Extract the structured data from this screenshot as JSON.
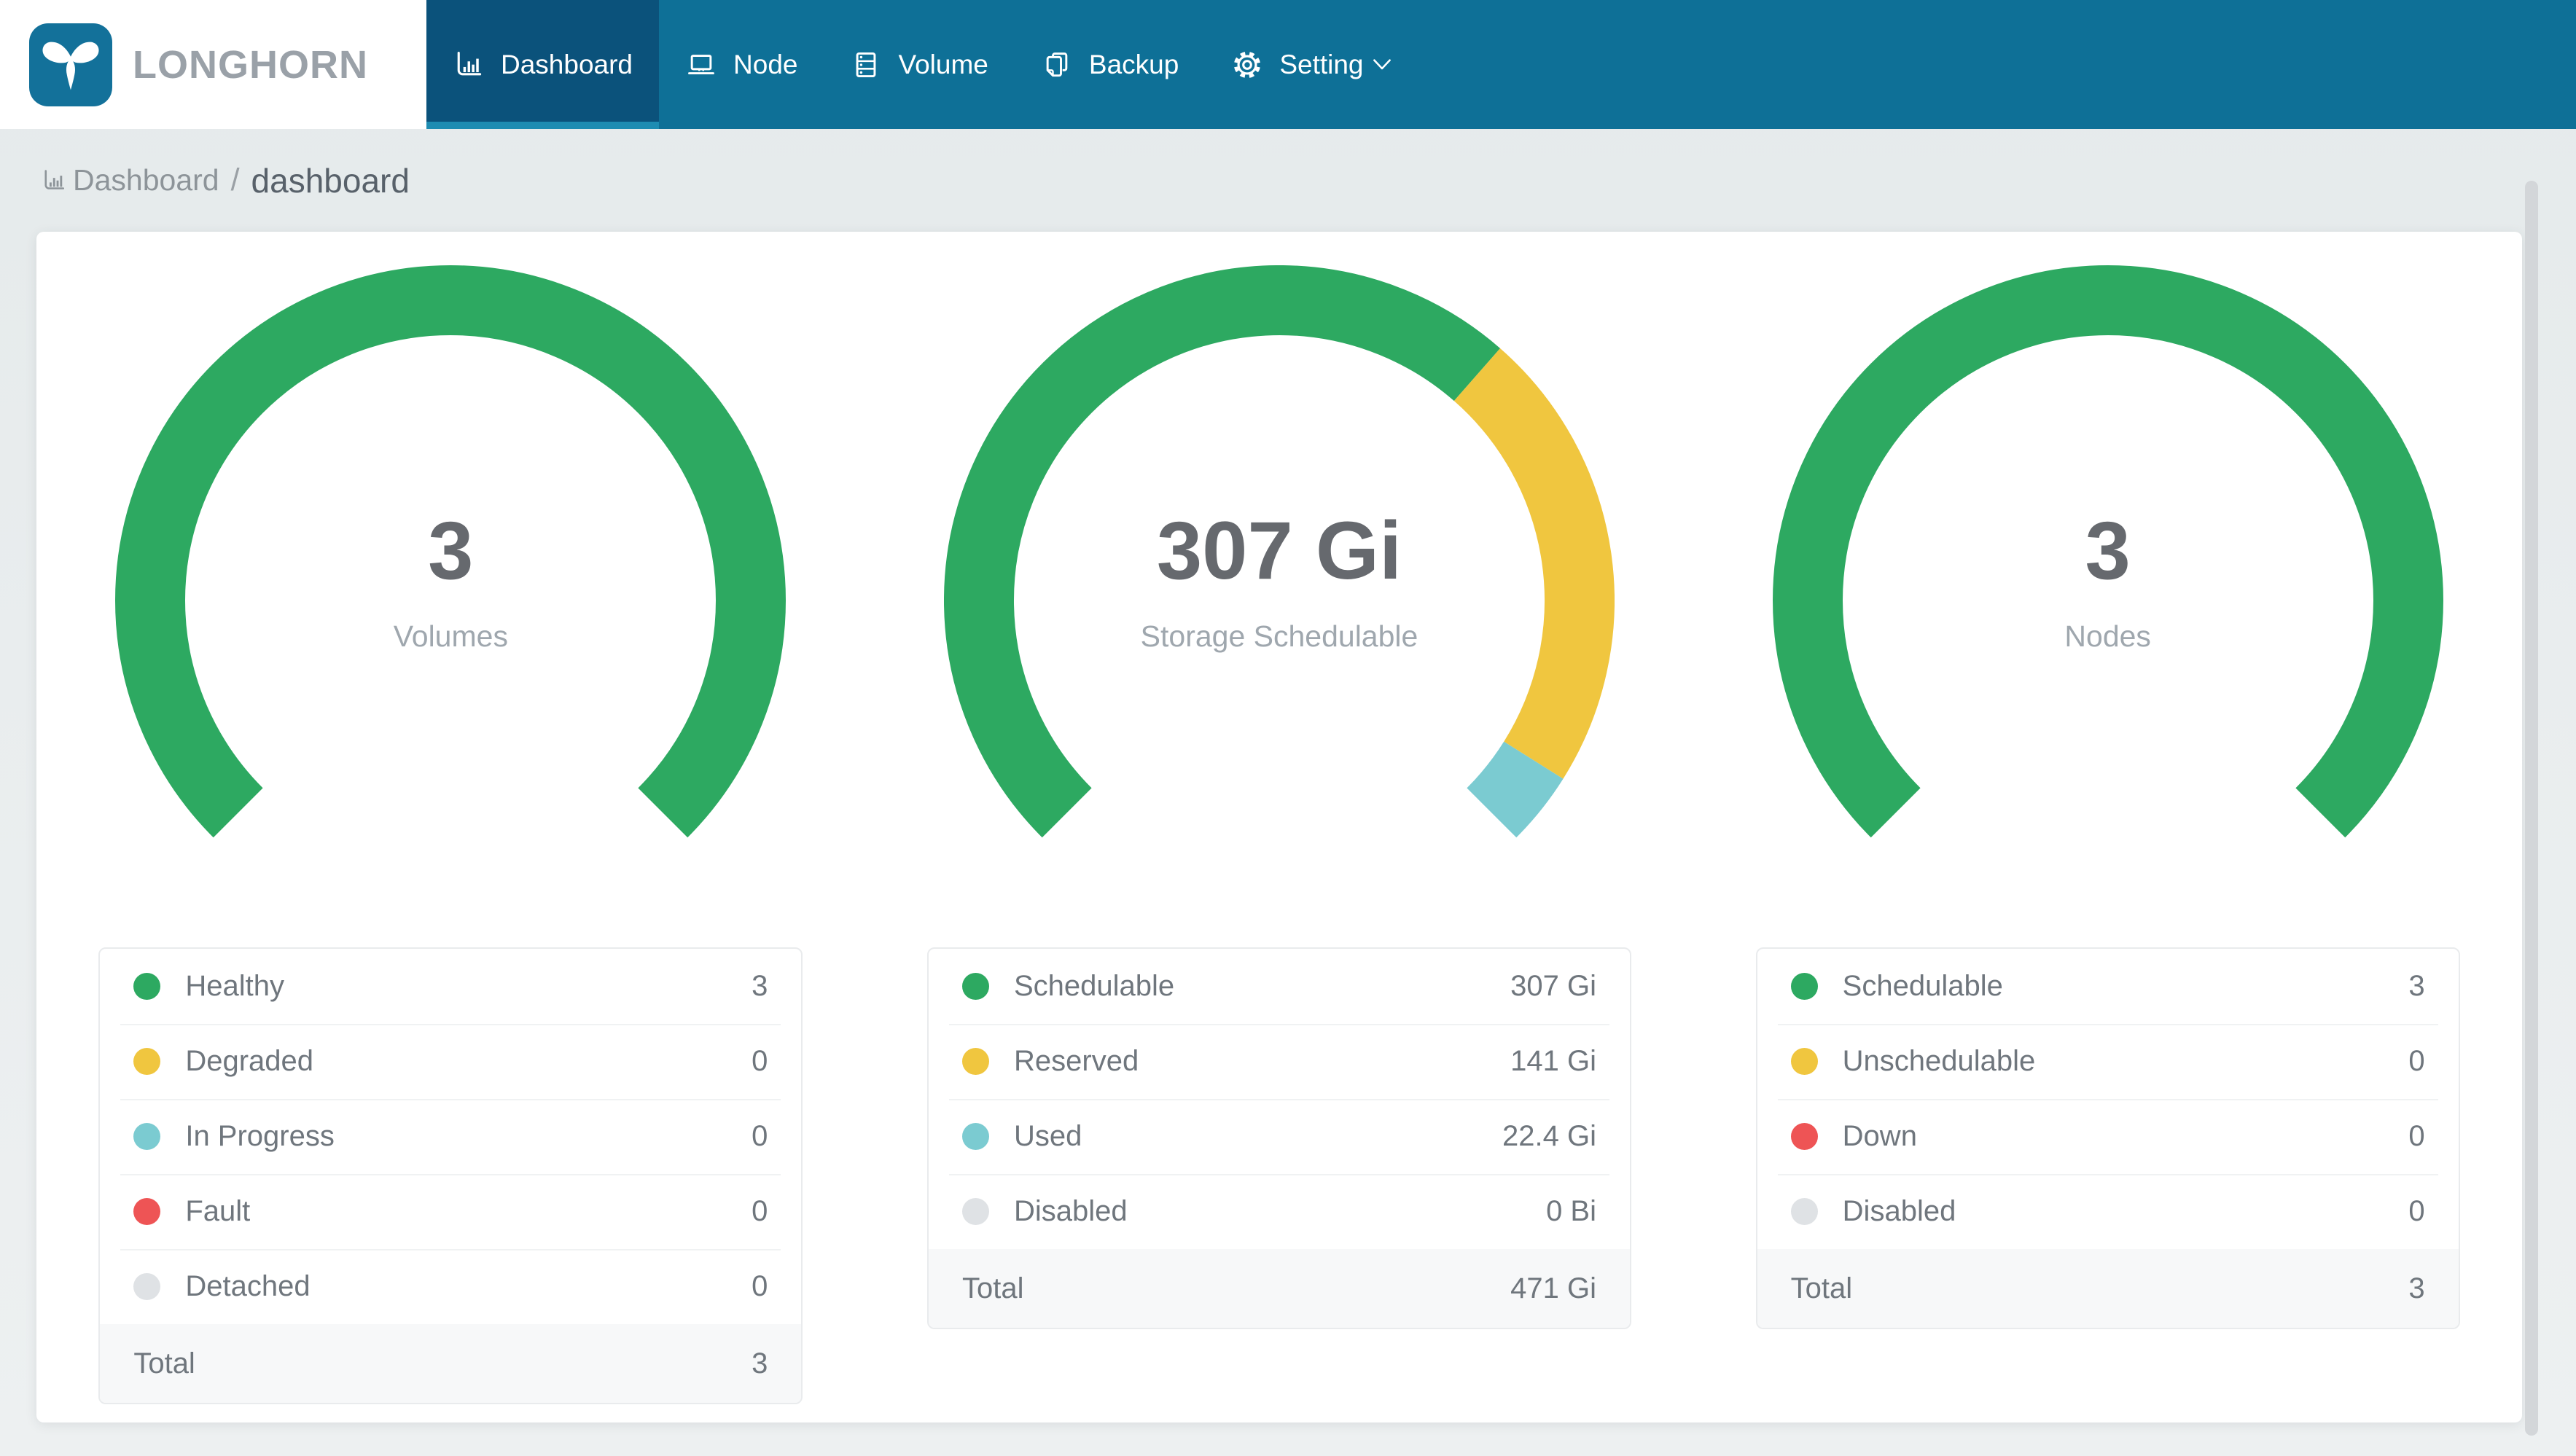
{
  "brand": {
    "name": "LONGHORN"
  },
  "nav": {
    "background": "#0e7097",
    "active_background": "#0b527b",
    "active_underline": "#1e8cb2",
    "items": [
      {
        "label": "Dashboard",
        "icon": "bar-chart-icon",
        "active": true
      },
      {
        "label": "Node",
        "icon": "laptop-icon",
        "active": false
      },
      {
        "label": "Volume",
        "icon": "database-icon",
        "active": false
      },
      {
        "label": "Backup",
        "icon": "copy-icon",
        "active": false
      },
      {
        "label": "Setting",
        "icon": "gear-icon",
        "active": false,
        "has_dropdown": true
      }
    ]
  },
  "breadcrumb": {
    "icon": "bar-chart-icon",
    "root": "Dashboard",
    "separator": "/",
    "current": "dashboard"
  },
  "chart_data": [
    {
      "type": "donut",
      "title": "Volumes",
      "gauge": {
        "start_angle": -135,
        "end_angle": 135
      },
      "center_value": "3",
      "center_label": "Volumes",
      "segments": [
        {
          "label": "Healthy",
          "value": 3,
          "display": "3",
          "color": "#2da961"
        },
        {
          "label": "Degraded",
          "value": 0,
          "display": "0",
          "color": "#f0c63f"
        },
        {
          "label": "In Progress",
          "value": 0,
          "display": "0",
          "color": "#7bcbd1"
        },
        {
          "label": "Fault",
          "value": 0,
          "display": "0",
          "color": "#ee5455"
        },
        {
          "label": "Detached",
          "value": 0,
          "display": "0",
          "color": "#dfe2e5"
        }
      ],
      "total": {
        "label": "Total",
        "display": "3"
      }
    },
    {
      "type": "donut",
      "title": "Storage Schedulable",
      "gauge": {
        "start_angle": -135,
        "end_angle": 135
      },
      "center_value": "307 Gi",
      "center_label": "Storage Schedulable",
      "segments": [
        {
          "label": "Schedulable",
          "value": 307,
          "display": "307 Gi",
          "color": "#2da961"
        },
        {
          "label": "Reserved",
          "value": 141,
          "display": "141 Gi",
          "color": "#f0c63f"
        },
        {
          "label": "Used",
          "value": 22.4,
          "display": "22.4 Gi",
          "color": "#7bcbd1"
        },
        {
          "label": "Disabled",
          "value": 0,
          "display": "0 Bi",
          "color": "#dfe2e5"
        }
      ],
      "total": {
        "label": "Total",
        "display": "471 Gi"
      }
    },
    {
      "type": "donut",
      "title": "Nodes",
      "gauge": {
        "start_angle": -135,
        "end_angle": 135
      },
      "center_value": "3",
      "center_label": "Nodes",
      "segments": [
        {
          "label": "Schedulable",
          "value": 3,
          "display": "3",
          "color": "#2da961"
        },
        {
          "label": "Unschedulable",
          "value": 0,
          "display": "0",
          "color": "#f0c63f"
        },
        {
          "label": "Down",
          "value": 0,
          "display": "0",
          "color": "#ee5455"
        },
        {
          "label": "Disabled",
          "value": 0,
          "display": "0",
          "color": "#dfe2e5"
        }
      ],
      "total": {
        "label": "Total",
        "display": "3"
      }
    }
  ],
  "colors": {
    "green": "#2da961",
    "yellow": "#f0c63f",
    "teal": "#7bcbd1",
    "red": "#ee5455",
    "gray": "#dfe2e5",
    "nav_blue": "#0e7097",
    "active_blue": "#0b527b"
  }
}
